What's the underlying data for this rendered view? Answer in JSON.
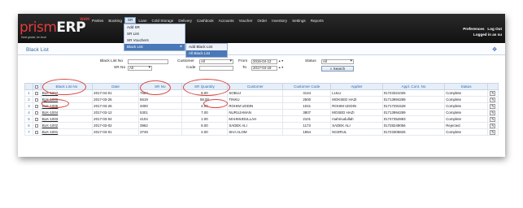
{
  "header": {
    "brand_part1": "prism",
    "brand_part2": "ERP",
    "brand_badge": "WHM",
    "tagline": "think global, be local",
    "menu": [
      "Parties",
      "Booking",
      "SR",
      "Loan",
      "Cold Storage",
      "Delivery",
      "Cashbook",
      "Accounts",
      "Voucher",
      "Order",
      "Inventory",
      "Settings",
      "Reports"
    ],
    "active_menu": "SR",
    "preferences_label": "Preferences",
    "logout_label": "Log Out",
    "logged_in_label": "Logged in as su"
  },
  "sr_dropdown": {
    "items": [
      "Add SR",
      "SR List",
      "SR Vouchers",
      "Black List"
    ],
    "highlighted": "Black List"
  },
  "black_list_submenu": {
    "items": [
      "Add Black List",
      "All Black List"
    ],
    "highlighted": "All Black List"
  },
  "page": {
    "title": "Black List",
    "add_icon": "plus-icon"
  },
  "filters": {
    "black_list_no_label": "Black List No",
    "black_list_no_value": "",
    "sr_no_label": "SR No",
    "sr_no_value": "All",
    "customer_label": "Customer",
    "customer_value": "All",
    "code_label": "Code",
    "code_value": "",
    "from_label": "From",
    "from_value": "2016-04-12",
    "to_label": "To",
    "to_value": "2017-04-19",
    "status_label": "Status",
    "status_value": "All",
    "search_label": "Search"
  },
  "table": {
    "headers": [
      "Black List No",
      "Date",
      "SR No",
      "SR Quantity",
      "Customer",
      "Customer Code",
      "Applier",
      "Appl. Cont. No",
      "Status"
    ],
    "rows": [
      {
        "idx": "1",
        "no": "BLK-1007",
        "date": "2017-04-01",
        "sr": "7684",
        "qty": "8.00",
        "customer": "SOBUJ",
        "code": "4144",
        "applier": "LULU",
        "contact": "01723321026",
        "status": "Complete"
      },
      {
        "idx": "2",
        "no": "BLK-1006",
        "date": "2017-03-26",
        "sr": "5619",
        "qty": "58.00",
        "customer": "TINKU",
        "code": "2500",
        "applier": "MOKSED HAZI",
        "contact": "01713994289",
        "status": "Complete"
      },
      {
        "idx": "3",
        "no": "BLK-1005",
        "date": "2017-03-26",
        "sr": "2000",
        "qty": "4.00",
        "customer": "ROHIM UDDIN",
        "code": "1041",
        "applier": "ROHIM UDDIN",
        "contact": "01717291528",
        "status": "Complete"
      },
      {
        "idx": "4",
        "no": "BLK-1004",
        "date": "2017-03-12",
        "sr": "5301",
        "qty": "7.00",
        "customer": "NURUJAMAN",
        "code": "3807",
        "applier": "MOSED HAZI",
        "contact": "01713994289",
        "status": "Complete"
      },
      {
        "idx": "5",
        "no": "BLK-1003",
        "date": "2017-03-04",
        "sr": "4104",
        "qty": "1.00",
        "customer": "MAHMUDULLAH",
        "code": "2101",
        "applier": "mahmudullah",
        "contact": "01747352883",
        "status": "Complete"
      },
      {
        "idx": "6",
        "no": "BLK-1002",
        "date": "2017-03-02",
        "sr": "3962",
        "qty": "8.00",
        "customer": "SADEK ALI",
        "code": "1173",
        "applier": "SADEK ALI",
        "contact": "01728249056",
        "status": "Rejected"
      },
      {
        "idx": "7",
        "no": "BLK-1001",
        "date": "2017-03-01",
        "sr": "3749",
        "qty": "4.00",
        "customer": "SHA ALOM",
        "code": "1954",
        "applier": "NOZRUL",
        "contact": "01723305825",
        "status": "Complete"
      }
    ]
  },
  "colors": {
    "header_bg": "#111111",
    "brand_red": "#e03c3c",
    "link_blue": "#2f6db3",
    "highlight_blue": "#4a78b8",
    "annotation_red": "#d9463e"
  }
}
